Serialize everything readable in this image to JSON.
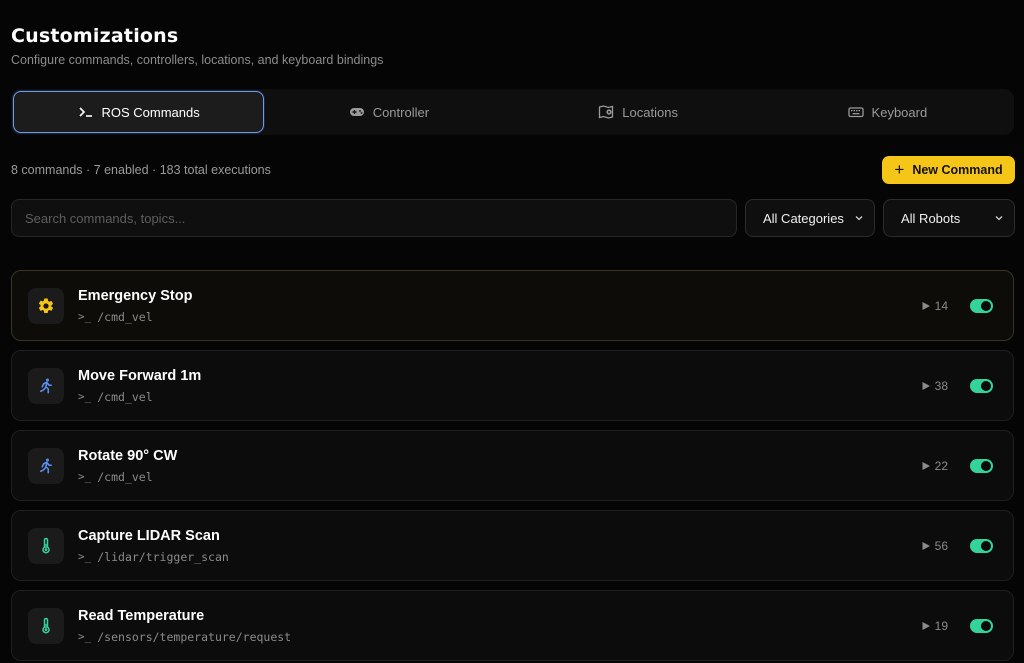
{
  "header": {
    "title": "Customizations",
    "subtitle": "Configure commands, controllers, locations, and keyboard bindings"
  },
  "tabs": [
    {
      "label": "ROS Commands",
      "icon": "terminal-icon",
      "active": true
    },
    {
      "label": "Controller",
      "icon": "gamepad-icon",
      "active": false
    },
    {
      "label": "Locations",
      "icon": "map-pin-icon",
      "active": false
    },
    {
      "label": "Keyboard",
      "icon": "keyboard-icon",
      "active": false
    }
  ],
  "stats": "8 commands · 7 enabled · 183 total executions",
  "new_command_label": "New Command",
  "search": {
    "placeholder": "Search commands, topics...",
    "value": ""
  },
  "filters": {
    "category": "All Categories",
    "robot": "All Robots"
  },
  "commands": [
    {
      "name": "Emergency Stop",
      "topic": "/cmd_vel",
      "runs": "14",
      "enabled": true,
      "icon": "gear-icon",
      "icon_color": "#f5c518"
    },
    {
      "name": "Move Forward 1m",
      "topic": "/cmd_vel",
      "runs": "38",
      "enabled": true,
      "icon": "running-person-icon",
      "icon_color": "#5b8def"
    },
    {
      "name": "Rotate 90° CW",
      "topic": "/cmd_vel",
      "runs": "22",
      "enabled": true,
      "icon": "running-person-icon",
      "icon_color": "#5b8def"
    },
    {
      "name": "Capture LIDAR Scan",
      "topic": "/lidar/trigger_scan",
      "runs": "56",
      "enabled": true,
      "icon": "thermometer-icon",
      "icon_color": "#34d399"
    },
    {
      "name": "Read Temperature",
      "topic": "/sensors/temperature/request",
      "runs": "19",
      "enabled": true,
      "icon": "thermometer-icon",
      "icon_color": "#34d399"
    }
  ],
  "colors": {
    "accent": "#f5c518",
    "enabled": "#34d399",
    "tab_focus": "#6b9bf0"
  }
}
